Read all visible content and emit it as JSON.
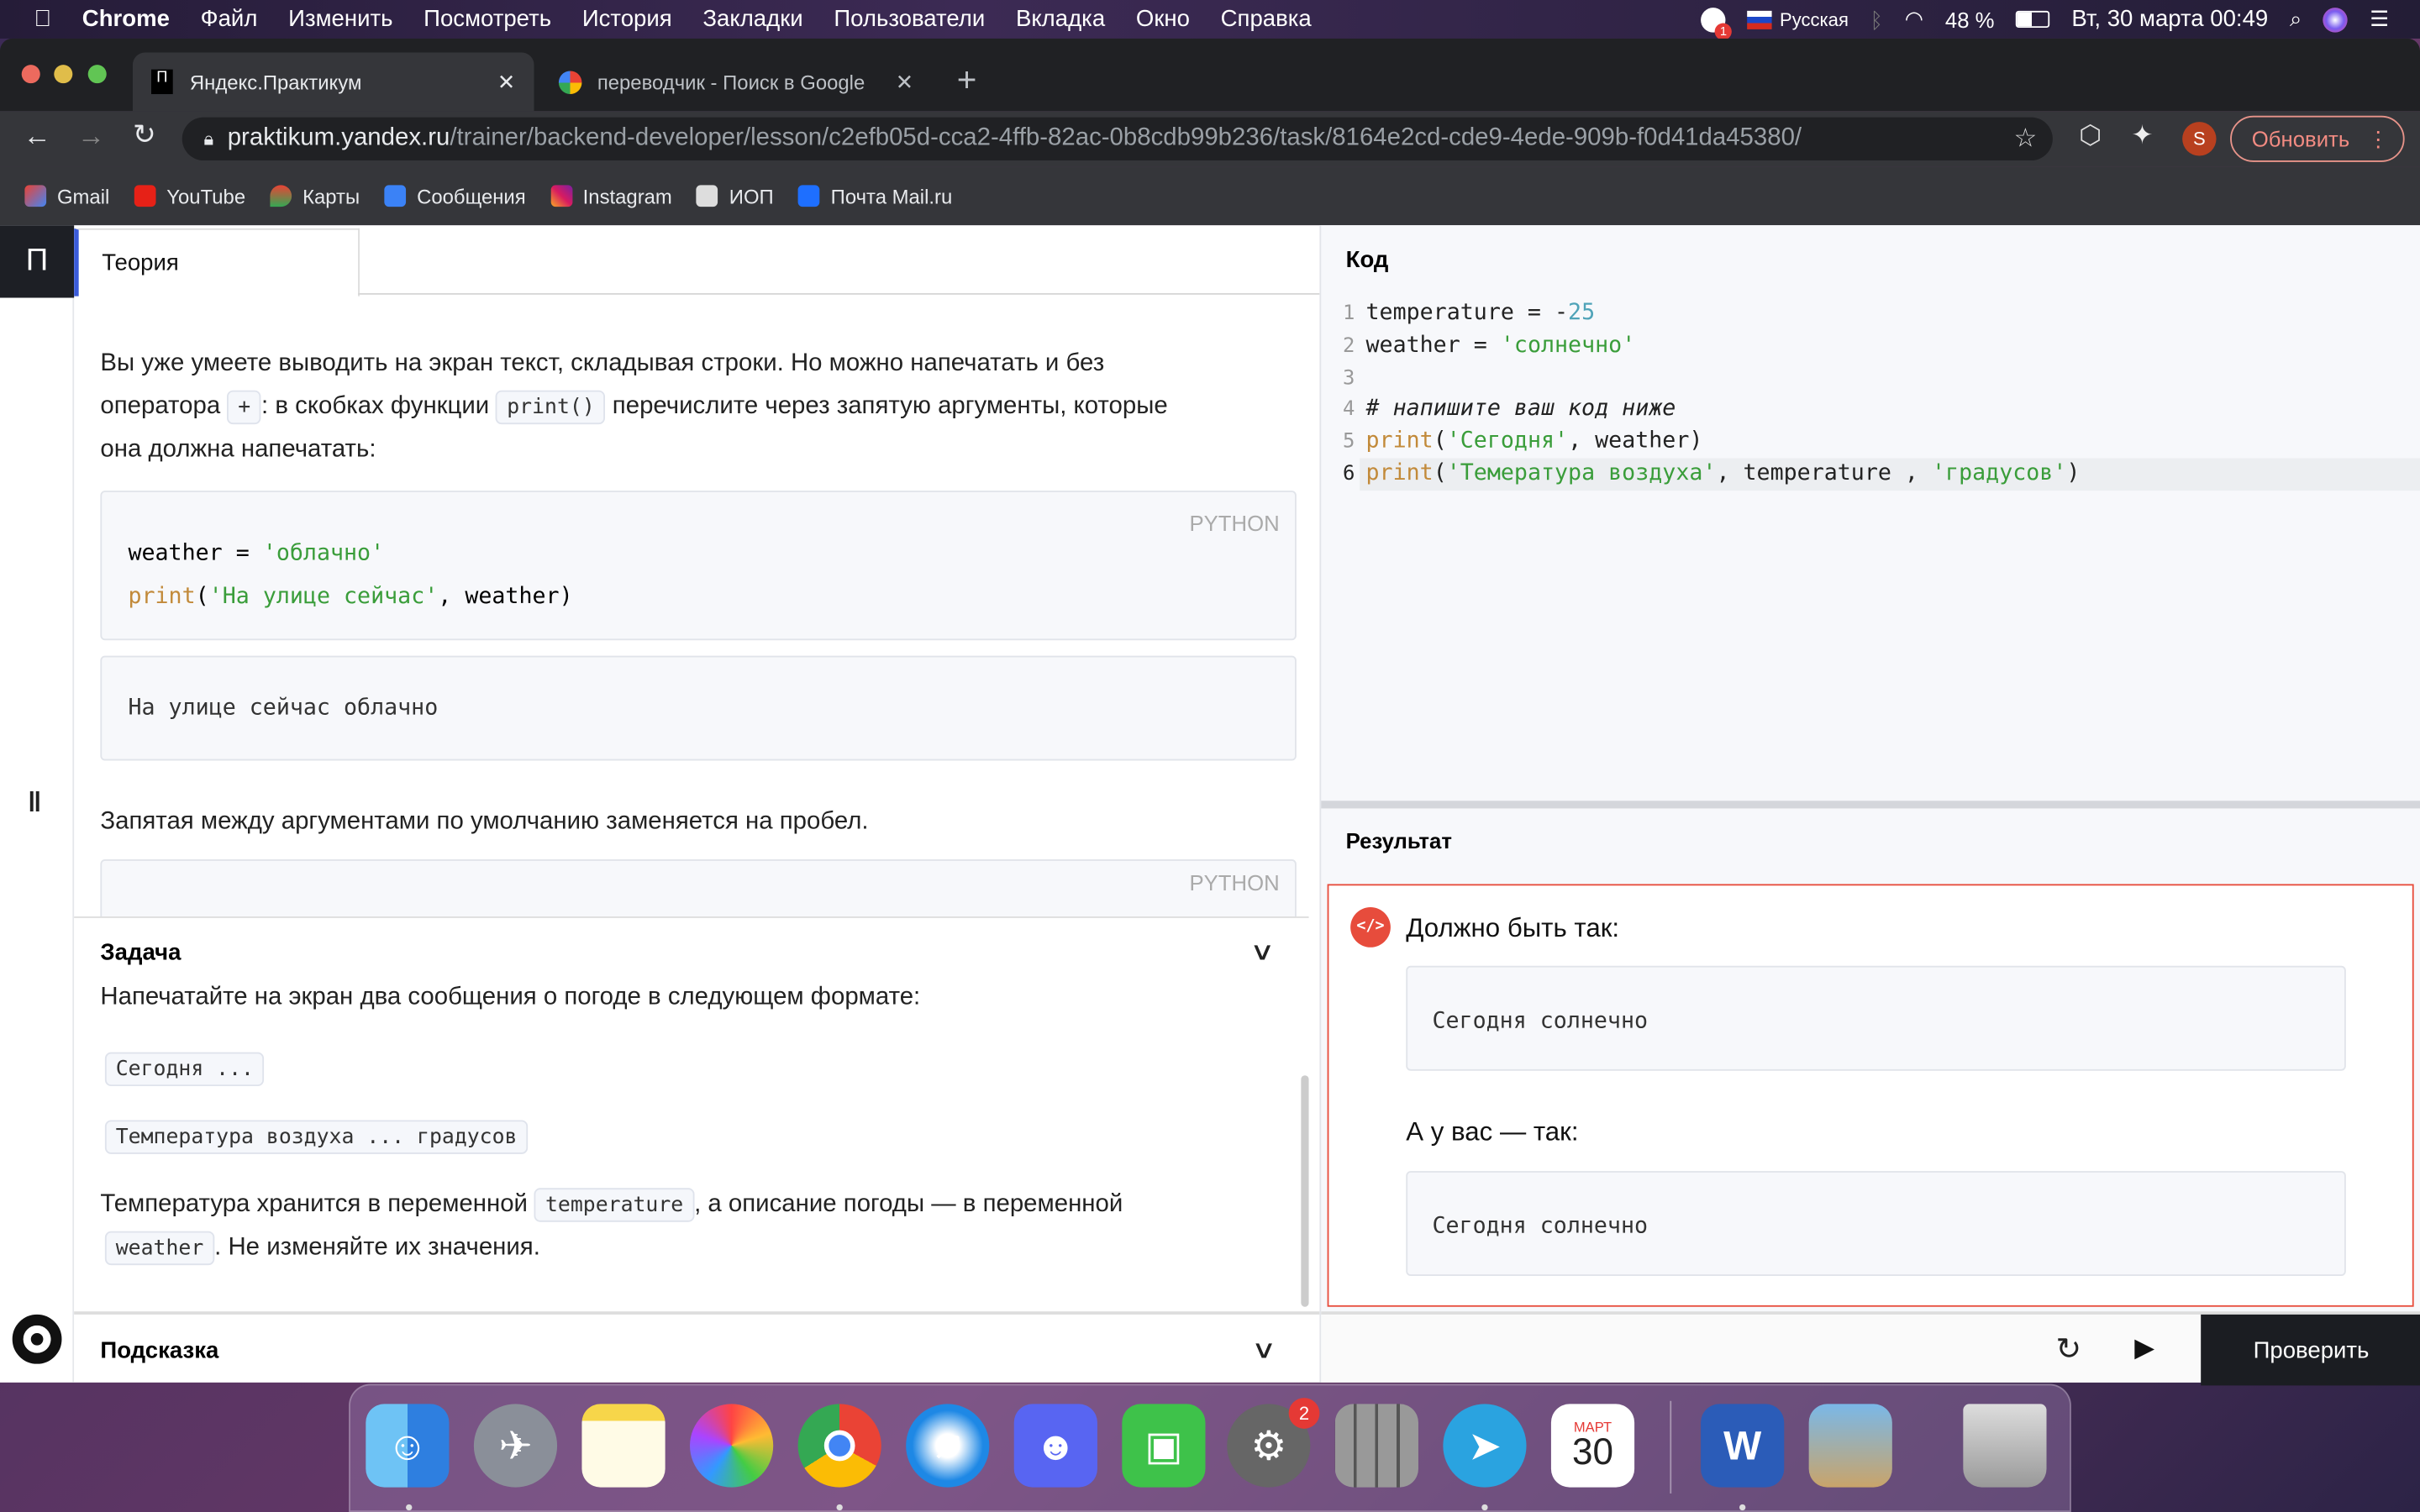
{
  "menubar": {
    "app": "Chrome",
    "items": [
      "Файл",
      "Изменить",
      "Посмотреть",
      "История",
      "Закладки",
      "Пользователи",
      "Вкладка",
      "Окно",
      "Справка"
    ],
    "notif_count": "1",
    "keyboard": "Русская",
    "battery": "48 %",
    "datetime": "Вт, 30 марта  00:49"
  },
  "browser": {
    "tabs": [
      {
        "title": "Яндекс.Практикум",
        "active": true
      },
      {
        "title": "переводчик - Поиск в Google",
        "active": false
      }
    ],
    "url_host": "praktikum.yandex.ru",
    "url_path": "/trainer/backend-developer/lesson/c2efb05d-cca2-4ffb-82ac-0b8cdb99b236/task/8164e2cd-cde9-4ede-909b-f0d41da45380/",
    "profile_initial": "S",
    "update_label": "Обновить",
    "bookmarks": [
      "Gmail",
      "YouTube",
      "Карты",
      "Сообщения",
      "Instagram",
      "ИОП",
      "Почта Mail.ru"
    ]
  },
  "theory": {
    "tab": "Теория",
    "p1a": "Вы уже умеете выводить на экран текст, складывая строки. Но можно напечатать и без",
    "p1b": "оператора",
    "op": "+",
    "p1c": ": в скобках функции",
    "fn": "print()",
    "p1d": "перечислите через запятую аргументы, которые",
    "p1e": "она должна напечатать:",
    "lang": "PYTHON",
    "ex1": {
      "l1a": "weather = ",
      "l1b": "'облачно'",
      "l2a": "print",
      "l2b": "(",
      "l2c": "'На улице сейчас'",
      "l2d": ", weather)"
    },
    "out1": "На улице сейчас облачно",
    "p2": "Запятая между аргументами по умолчанию заменяется на пробел.",
    "lang2": "PYTHON"
  },
  "task": {
    "title": "Задача",
    "text": "Напечатайте на экран два сообщения о погоде в следующем формате:",
    "fmt1": "Сегодня ...",
    "fmt2": "Температура воздуха ... градусов",
    "p_a": "Температура хранится в переменной",
    "var1": "temperature",
    "p_b": ", а описание погоды — в переменной",
    "var2": "weather",
    "p_c": ". Не изменяйте их значения."
  },
  "hint": {
    "title": "Подсказка"
  },
  "code": {
    "title": "Код",
    "lines": [
      {
        "n": "1",
        "a": "temperature = -",
        "b": "25"
      },
      {
        "n": "2",
        "a": "weather = ",
        "b": "'солнечно'"
      },
      {
        "n": "3"
      },
      {
        "n": "4",
        "c": "# напишите ваш код ниже"
      },
      {
        "n": "5",
        "k": "print",
        "p": "(",
        "s": "'Сегодня'",
        "r": ", weather)"
      },
      {
        "n": "6",
        "k": "print",
        "p": "(",
        "s": "'Темeратура воздуха'",
        "r": ", temperature , ",
        "s2": "'градусов'",
        "e": ")"
      }
    ]
  },
  "result": {
    "title": "Результат",
    "expected_label": "Должно быть так:",
    "expected": "Сегодня солнечно",
    "actual_label": "А у вас — так:",
    "actual": "Сегодня солнечно"
  },
  "actions": {
    "check": "Проверить"
  },
  "dock": {
    "system_prefs_badge": "2",
    "calendar_month": "МАРТ",
    "calendar_day": "30"
  },
  "colors": {
    "error": "#e74c3c",
    "accent": "#3a5bd9"
  }
}
